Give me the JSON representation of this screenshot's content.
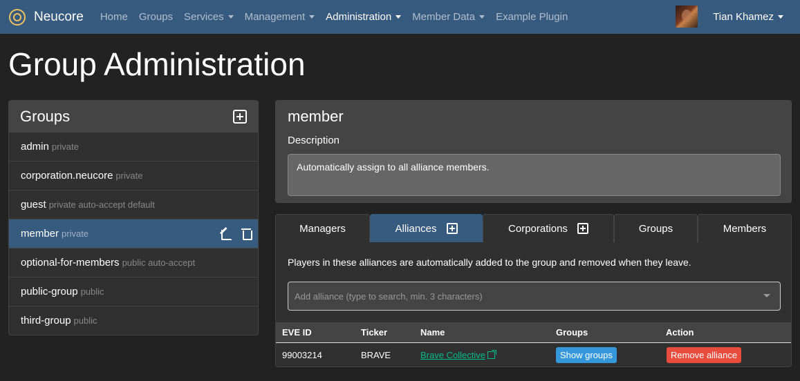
{
  "navbar": {
    "brand": "Neucore",
    "items": [
      {
        "label": "Home",
        "dropdown": false,
        "active": false
      },
      {
        "label": "Groups",
        "dropdown": false,
        "active": false
      },
      {
        "label": "Services",
        "dropdown": true,
        "active": false
      },
      {
        "label": "Management",
        "dropdown": true,
        "active": false
      },
      {
        "label": "Administration",
        "dropdown": true,
        "active": true
      },
      {
        "label": "Member Data",
        "dropdown": true,
        "active": false
      },
      {
        "label": "Example Plugin",
        "dropdown": false,
        "active": false
      }
    ],
    "user_name": "Tian Khamez"
  },
  "page_title": "Group Administration",
  "groups_panel": {
    "title": "Groups",
    "items": [
      {
        "name": "admin",
        "tags": "private",
        "active": false
      },
      {
        "name": "corporation.neucore",
        "tags": "private",
        "active": false
      },
      {
        "name": "guest",
        "tags": "private auto-accept default",
        "active": false
      },
      {
        "name": "member",
        "tags": "private",
        "active": true
      },
      {
        "name": "optional-for-members",
        "tags": "public auto-accept",
        "active": false
      },
      {
        "name": "public-group",
        "tags": "public",
        "active": false
      },
      {
        "name": "third-group",
        "tags": "public",
        "active": false
      }
    ]
  },
  "group_detail": {
    "name": "member",
    "description_label": "Description",
    "description": "Automatically assign to all alliance members."
  },
  "tabs": [
    {
      "label": "Managers",
      "active": false,
      "add": false
    },
    {
      "label": "Alliances",
      "active": true,
      "add": true
    },
    {
      "label": "Corporations",
      "active": false,
      "add": true
    },
    {
      "label": "Groups",
      "active": false,
      "add": false
    },
    {
      "label": "Members",
      "active": false,
      "add": false
    }
  ],
  "alliances": {
    "info": "Players in these alliances are automatically added to the group and removed when they leave.",
    "search_placeholder": "Add alliance (type to search, min. 3 characters)",
    "columns": [
      "EVE ID",
      "Ticker",
      "Name",
      "Groups",
      "Action"
    ],
    "rows": [
      {
        "eve_id": "99003214",
        "ticker": "BRAVE",
        "name": "Brave Collective",
        "groups_button": "Show groups",
        "action_button": "Remove alliance"
      }
    ]
  },
  "colors": {
    "navbar": "#375a7f",
    "background": "#222222",
    "accent_link": "#00bc8c",
    "info": "#3498db",
    "danger": "#e74c3c"
  }
}
